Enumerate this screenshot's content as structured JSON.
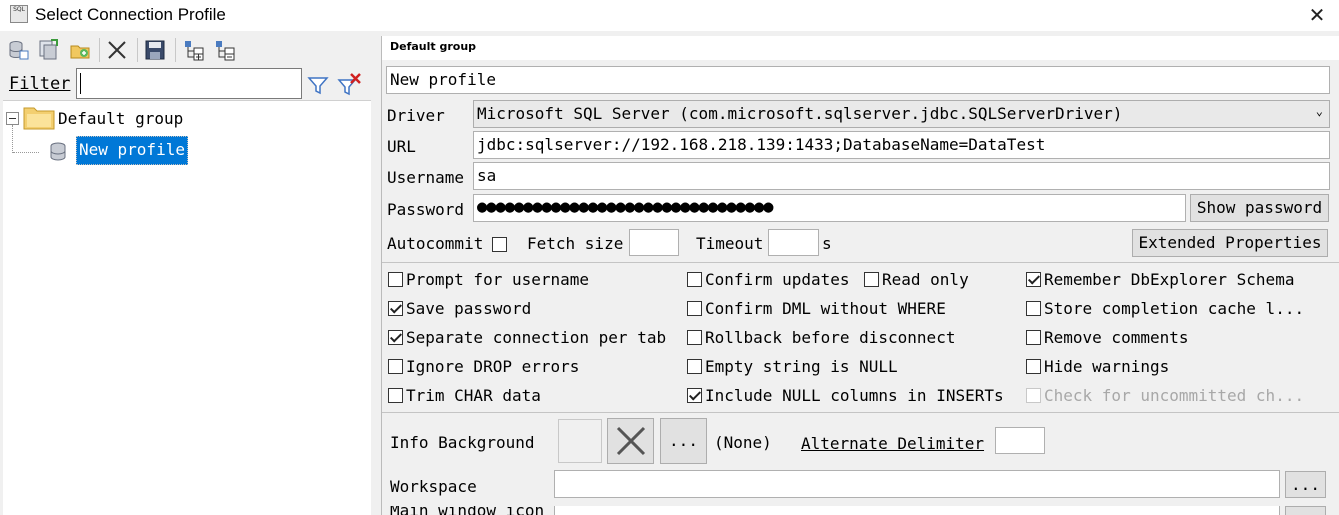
{
  "window": {
    "title": "Select Connection Profile",
    "app_icon_text": "SQL"
  },
  "filter": {
    "label": "Filter",
    "value": ""
  },
  "tree": {
    "group": "Default group",
    "profile": "New profile"
  },
  "profile": {
    "group_header": "Default group",
    "name": "New profile",
    "driver_label": "Driver",
    "driver_value": "Microsoft SQL Server (com.microsoft.sqlserver.jdbc.SQLServerDriver)",
    "url_label": "URL",
    "url_value": "jdbc:sqlserver://192.168.218.139:1433;DatabaseName=DataTest",
    "username_label": "Username",
    "username_value": "sa",
    "password_label": "Password",
    "password_value": "●●●●●●●●●●●●●●●●●●●●●●●●●●●●●●●●",
    "show_password": "Show password",
    "autocommit_label": "Autocommit",
    "fetch_size_label": "Fetch size",
    "fetch_size_value": "",
    "timeout_label": "Timeout",
    "timeout_value": "",
    "timeout_unit": "s",
    "extended_properties": "Extended Properties"
  },
  "options": {
    "col1": [
      {
        "label": "Prompt for username",
        "checked": false
      },
      {
        "label": "Save password",
        "checked": true
      },
      {
        "label": "Separate connection per tab",
        "checked": true
      },
      {
        "label": "Ignore DROP errors",
        "checked": false
      },
      {
        "label": "Trim CHAR data",
        "checked": false
      }
    ],
    "col2": [
      {
        "label": "Confirm updates",
        "checked": false
      },
      {
        "label": "Confirm DML without WHERE",
        "checked": false
      },
      {
        "label": "Rollback before disconnect",
        "checked": false
      },
      {
        "label": "Empty string is NULL",
        "checked": false
      },
      {
        "label": "Include NULL columns in INSERTs",
        "checked": true
      }
    ],
    "read_only": {
      "label": "Read only",
      "checked": false
    },
    "col3": [
      {
        "label": "Remember DbExplorer Schema",
        "checked": true
      },
      {
        "label": "Store completion cache l...",
        "checked": false
      },
      {
        "label": "Remove comments",
        "checked": false
      },
      {
        "label": "Hide warnings",
        "checked": false
      },
      {
        "label": "Check for uncommitted ch...",
        "checked": false,
        "disabled": true
      }
    ]
  },
  "bottom": {
    "info_background_label": "Info Background",
    "ellipsis": "...",
    "info_background_value": "(None)",
    "alternate_delimiter_label": "Alternate Delimiter",
    "alternate_delimiter_value": "",
    "workspace_label": "Workspace",
    "workspace_value": "",
    "next_label_partial": "Main window icon"
  }
}
